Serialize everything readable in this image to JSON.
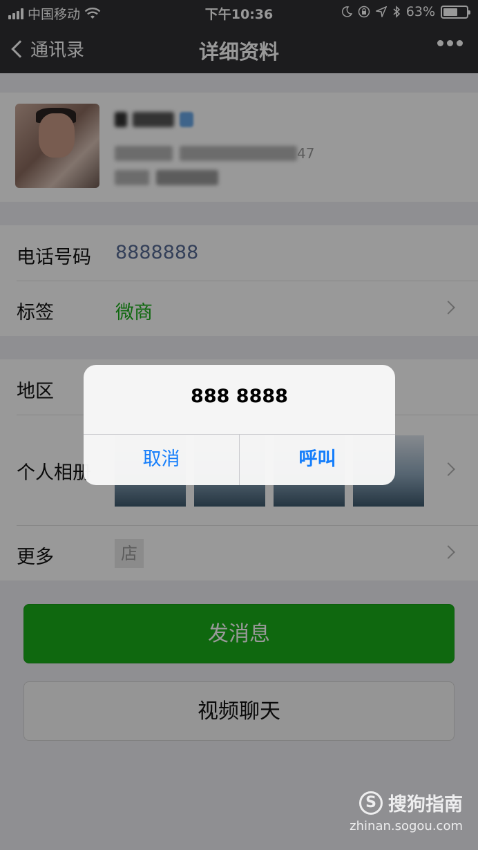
{
  "status_bar": {
    "carrier": "中国移动",
    "time": "下午10:36",
    "battery_text": "63%",
    "battery_level": 0.63,
    "icons": [
      "signal-icon",
      "wifi-icon",
      "moon-icon",
      "lock-rotation-icon",
      "location-icon",
      "bluetooth-icon",
      "battery-icon"
    ]
  },
  "nav": {
    "back_label": "通讯录",
    "title": "详细资料",
    "more_icon": "more-icon"
  },
  "profile": {
    "wechat_id_suffix": "47"
  },
  "rows": {
    "phone_label": "电话号码",
    "phone_value": "8888888",
    "tag_label": "标签",
    "tag_value": "微商",
    "region_label": "地区",
    "album_label": "个人相册",
    "more_label": "更多",
    "shop_icon_text": "店"
  },
  "buttons": {
    "send_message": "发消息",
    "video_chat": "视频聊天"
  },
  "alert": {
    "message": "888 8888",
    "cancel": "取消",
    "call": "呼叫"
  },
  "watermark": {
    "brand": "搜狗指南",
    "url": "zhinan.sogou.com"
  },
  "colors": {
    "nav_bg": "#2f2f33",
    "green": "#1aad19",
    "ios_blue": "#157efb",
    "phone_blue": "#576b95",
    "tag_green": "#1aad19"
  }
}
